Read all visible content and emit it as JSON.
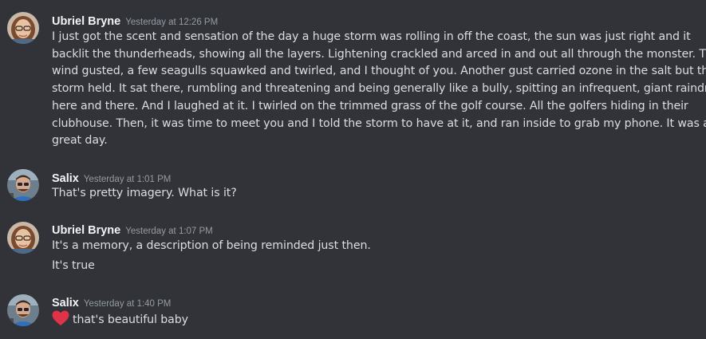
{
  "messages": [
    {
      "author": "Ubriel Bryne",
      "timestamp": "Yesterday at 12:26 PM",
      "lines": [
        "I  just got the scent and sensation of the day a huge storm was rolling in off the coast, the sun was just right and it",
        "backlit the thunderheads, showing all the layers. Lightening crackled and arced in and out all through the monster. The",
        "wind gusted, a few seagulls squawked and twirled, and I thought of you. Another gust carried ozone in the salt but the",
        "storm held. It sat there, rumbling and threatening and being generally like a bully, spitting an infrequent, giant raindrop",
        "here and there. And I laughed at it. I twirled on the trimmed grass of the golf course. All the golfers hiding in their",
        "clubhouse. Then, it was time to meet you and I told the storm to have at it, and ran inside to grab my phone. It was a",
        "great day."
      ]
    },
    {
      "author": "Salix",
      "timestamp": "Yesterday at 1:01 PM",
      "lines": [
        "That's pretty imagery.  What is it?"
      ]
    },
    {
      "author": "Ubriel Bryne",
      "timestamp": "Yesterday at 1:07 PM",
      "lines": [
        "It's a memory, a description of being reminded just then."
      ],
      "followup": "It's true"
    },
    {
      "author": "Salix",
      "timestamp": "Yesterday at 1:40 PM",
      "emoji": "heart-emoji",
      "lines": [
        "that's beautiful baby"
      ]
    }
  ],
  "colors": {
    "background": "#313338",
    "author": "#f2f3f5",
    "timestamp": "#949ba4",
    "text": "#dbdee1",
    "heart": "#e0334a"
  }
}
